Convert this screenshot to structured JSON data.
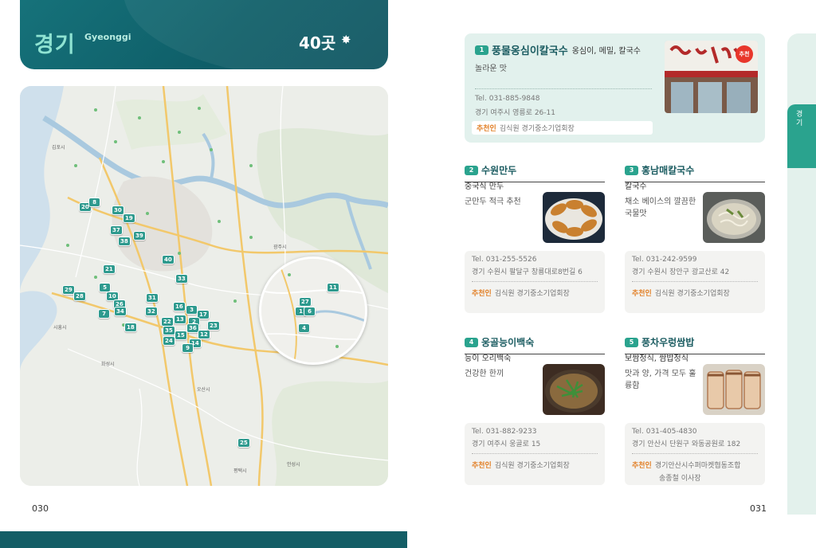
{
  "header": {
    "region_ko": "경기",
    "region_en": "Gyeonggi",
    "count": "40곳",
    "star_icon": "✸"
  },
  "map": {
    "pins": [
      "20",
      "8",
      "30",
      "19",
      "37",
      "39",
      "38",
      "40",
      "21",
      "33",
      "29",
      "5",
      "10",
      "28",
      "26",
      "34",
      "7",
      "31",
      "32",
      "16",
      "3",
      "17",
      "22",
      "13",
      "2",
      "35",
      "36",
      "12",
      "23",
      "15",
      "24",
      "14",
      "9",
      "18",
      "25"
    ],
    "zoom_pins": [
      "11",
      "27",
      "1",
      "6",
      "4"
    ],
    "labels": [
      "김포시",
      "광주시",
      "화성시",
      "오산시",
      "평택시",
      "안성시",
      "시흥시"
    ]
  },
  "page_left": "030",
  "page_right": "031",
  "side_tab": {
    "label": "경기"
  },
  "restaurants": [
    {
      "num": "1",
      "name": "풍물옹심이칼국수",
      "menu": "옹심이, 메밀, 칼국수",
      "desc": "놀라운 맛",
      "tel": "Tel. 031-885-9848",
      "addr": "경기 여주시 영릉로 26-11",
      "rec_label": "추천인",
      "rec": "김식원 경기중소기업회장",
      "badge": "추천",
      "photo_icon": "restaurant-storefront-photo"
    },
    {
      "num": "2",
      "name": "수원만두",
      "menu": "중국식 만두",
      "desc": "군만두 적극 추천",
      "tel": "Tel. 031-255-5526",
      "addr": "경기 수원시 팔달구 창룡대로8번길 6",
      "rec_label": "추천인",
      "rec": "김식원 경기중소기업회장",
      "photo_icon": "fried-dumplings-photo"
    },
    {
      "num": "3",
      "name": "홍남매칼국수",
      "menu": "칼국수",
      "desc": "채소 베이스의 깔끔한 국물맛",
      "tel": "Tel. 031-242-9599",
      "addr": "경기 수원시 장안구 광교산로 42",
      "rec_label": "추천인",
      "rec": "김식원 경기중소기업회장",
      "photo_icon": "noodle-soup-photo"
    },
    {
      "num": "4",
      "name": "웅골능이백숙",
      "menu": "능이 오리백숙",
      "desc": "건강한 한끼",
      "tel": "Tel. 031-882-9233",
      "addr": "경기 여주시 웅골로 15",
      "rec_label": "추천인",
      "rec": "김식원 경기중소기업회장",
      "photo_icon": "duck-stew-photo"
    },
    {
      "num": "5",
      "name": "풍차우렁쌈밥",
      "menu": "보쌈정식, 쌈밥정식",
      "desc": "맛과 양, 가격 모두 훌륭함",
      "tel": "Tel. 031-405-4830",
      "addr": "경기 안산시 단원구 와동공원로 182",
      "rec_label": "추천인",
      "rec": "경기안산시수퍼마켓협동조합",
      "rec2": "송종철 이사장",
      "photo_icon": "bossam-pork-photo"
    }
  ]
}
